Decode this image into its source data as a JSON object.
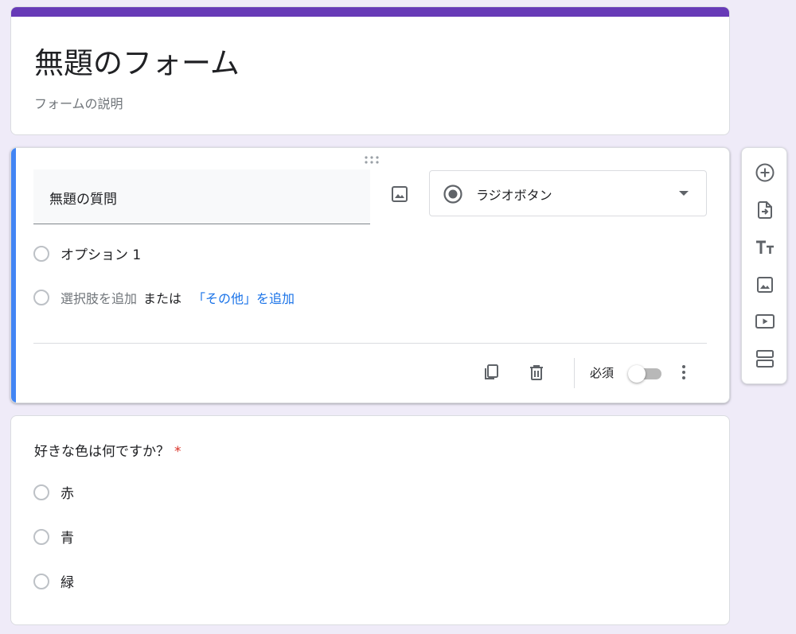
{
  "form": {
    "title": "無題のフォーム",
    "description": "フォームの説明",
    "theme_color": "#673ab7"
  },
  "active_question": {
    "accent_color": "#4285f4",
    "title": "無題の質問",
    "type_label": "ラジオボタン",
    "options": [
      {
        "label": "オプション 1"
      }
    ],
    "add_option": {
      "label": "選択肢を追加",
      "or_text": "または",
      "add_other_label": "「その他」を追加"
    },
    "footer": {
      "copy_icon": "copy-icon",
      "delete_icon": "trash-icon",
      "required_label": "必須",
      "required": false,
      "more_icon": "more-vert-icon"
    }
  },
  "toolbar": {
    "items": [
      {
        "icon": "add-circle-icon"
      },
      {
        "icon": "import-questions-icon"
      },
      {
        "icon": "title-text-icon"
      },
      {
        "icon": "image-icon"
      },
      {
        "icon": "video-icon"
      },
      {
        "icon": "section-icon"
      }
    ]
  },
  "second_question": {
    "title": "好きな色は何ですか？",
    "required_mark": "*",
    "options": [
      {
        "label": "赤"
      },
      {
        "label": "青"
      },
      {
        "label": "緑"
      }
    ]
  }
}
